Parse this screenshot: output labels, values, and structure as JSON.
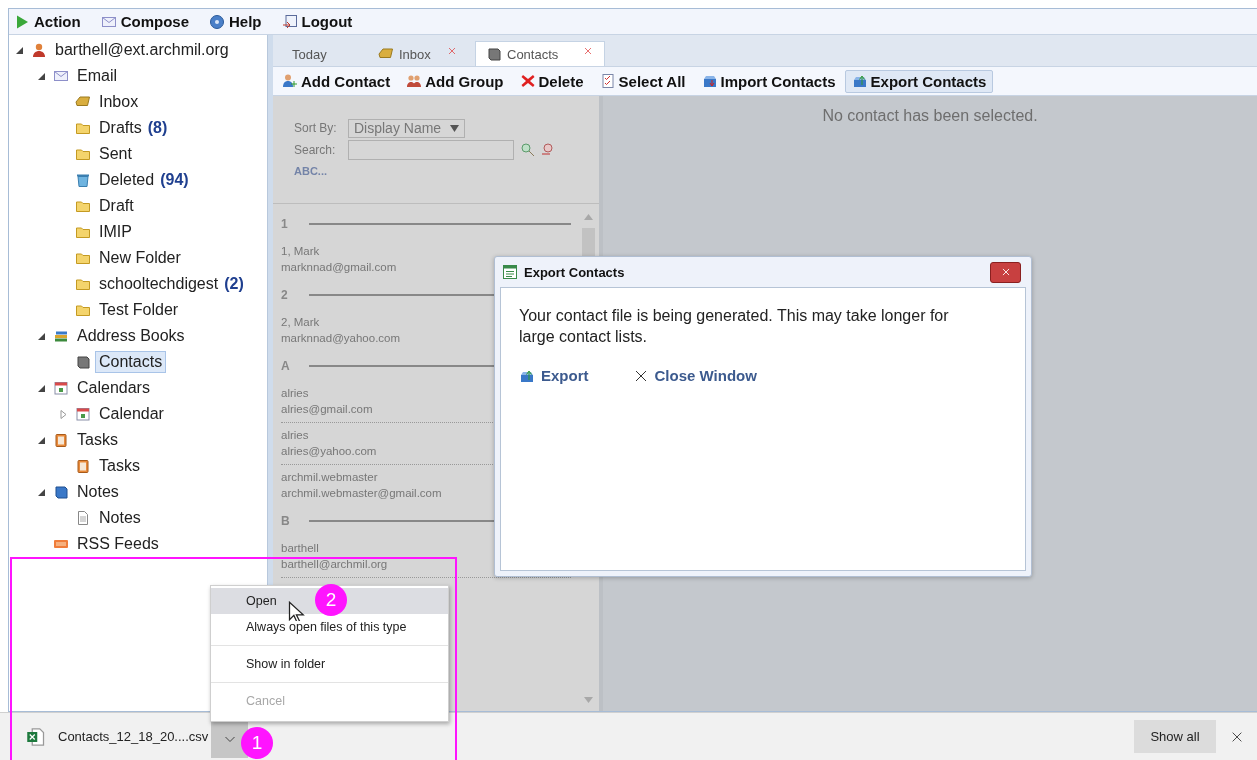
{
  "menu": [
    {
      "label": "Action",
      "kind": "action"
    },
    {
      "label": "Compose",
      "kind": "compose"
    },
    {
      "label": "Help",
      "kind": "help"
    },
    {
      "label": "Logout",
      "kind": "logout"
    }
  ],
  "tree": [
    {
      "label": "barthell@ext.archmil.org",
      "kind": "account",
      "expanded": true,
      "selected": false,
      "children": [
        {
          "label": "Email",
          "kind": "mail",
          "expanded": true,
          "selected": false,
          "children": [
            {
              "label": "Inbox",
              "kind": "inbox",
              "selected": false
            },
            {
              "label": "Drafts",
              "count": "(8)",
              "kind": "drafts",
              "selected": false
            },
            {
              "label": "Sent",
              "kind": "sent",
              "selected": false
            },
            {
              "label": "Deleted",
              "count": "(94)",
              "kind": "trash",
              "selected": false
            },
            {
              "label": "Draft",
              "kind": "folder",
              "selected": false
            },
            {
              "label": "IMIP",
              "kind": "folder",
              "selected": false
            },
            {
              "label": "New Folder",
              "kind": "folder",
              "selected": false
            },
            {
              "label": "schooltechdigest",
              "count": "(2)",
              "kind": "folder",
              "selected": false
            },
            {
              "label": "Test Folder",
              "kind": "folder",
              "selected": false
            }
          ]
        },
        {
          "label": "Address Books",
          "kind": "addressbooks",
          "expanded": true,
          "selected": false,
          "children": [
            {
              "label": "Contacts",
              "kind": "contacts",
              "selected": true
            }
          ]
        },
        {
          "label": "Calendars",
          "kind": "calendars",
          "expanded": true,
          "selected": false,
          "children": [
            {
              "label": "Calendar",
              "kind": "calendar",
              "expanded": false,
              "selected": false
            }
          ]
        },
        {
          "label": "Tasks",
          "kind": "taskfolder",
          "expanded": true,
          "selected": false,
          "children": [
            {
              "label": "Tasks",
              "kind": "tasks",
              "selected": false
            }
          ]
        },
        {
          "label": "Notes",
          "kind": "notesfolder",
          "expanded": true,
          "selected": false,
          "children": [
            {
              "label": "Notes",
              "kind": "note",
              "selected": false
            }
          ]
        },
        {
          "label": "RSS Feeds",
          "kind": "rss",
          "selected": false
        }
      ]
    }
  ],
  "tabs": [
    {
      "label": "Today",
      "kind": "today",
      "closable": false,
      "selected": false
    },
    {
      "label": "Inbox",
      "kind": "inbox",
      "closable": true,
      "selected": false
    },
    {
      "label": "Contacts",
      "kind": "contacts",
      "closable": true,
      "selected": true
    }
  ],
  "toolbar": [
    {
      "label": "Add Contact",
      "kind": "add-contact",
      "pressed": false
    },
    {
      "label": "Add Group",
      "kind": "add-group",
      "pressed": false
    },
    {
      "label": "Delete",
      "kind": "delete",
      "pressed": false
    },
    {
      "label": "Select All",
      "kind": "select-all",
      "pressed": false
    },
    {
      "label": "Import Contacts",
      "kind": "import",
      "pressed": false
    },
    {
      "label": "Export Contacts",
      "kind": "export",
      "pressed": true
    }
  ],
  "contact_list": {
    "sort_label": "Sort By:",
    "sort_value": "Display Name",
    "search_label": "Search:",
    "abc_link": "ABC...",
    "groups": [
      {
        "heading": "1",
        "contacts": [
          {
            "name": "1, Mark",
            "email": "marknnad@gmail.com"
          }
        ]
      },
      {
        "heading": "2",
        "contacts": [
          {
            "name": "2, Mark",
            "email": "marknnad@yahoo.com"
          }
        ]
      },
      {
        "heading": "A",
        "contacts": [
          {
            "name": "alries",
            "email": "alries@gmail.com"
          },
          {
            "name": "alries",
            "email": "alries@yahoo.com"
          },
          {
            "name": "archmil.webmaster",
            "email": "archmil.webmaster@gmail.com"
          }
        ]
      },
      {
        "heading": "B",
        "contacts": [
          {
            "name": "barthell",
            "email": "barthell@archmil.org"
          }
        ]
      }
    ]
  },
  "detail": {
    "message": "No contact has been selected."
  },
  "dialog": {
    "title": "Export Contacts",
    "message": "Your contact file is being generated. This may take longer for large contact lists.",
    "actions": [
      {
        "label": "Export",
        "kind": "export"
      },
      {
        "label": "Close Window",
        "kind": "close"
      }
    ]
  },
  "download_bar": {
    "file": "Contacts_12_18_20....csv",
    "callout": "1",
    "show_all": "Show all"
  },
  "context_menu": {
    "callout": "2",
    "sections": [
      {
        "items": [
          {
            "label": "Open",
            "selected": true,
            "disabled": false
          },
          {
            "label": "Always open files of this type",
            "selected": false,
            "disabled": false
          }
        ]
      },
      {
        "items": [
          {
            "label": "Show in folder",
            "selected": false,
            "disabled": false
          }
        ]
      },
      {
        "items": [
          {
            "label": "Cancel",
            "selected": false,
            "disabled": true
          }
        ]
      }
    ]
  }
}
